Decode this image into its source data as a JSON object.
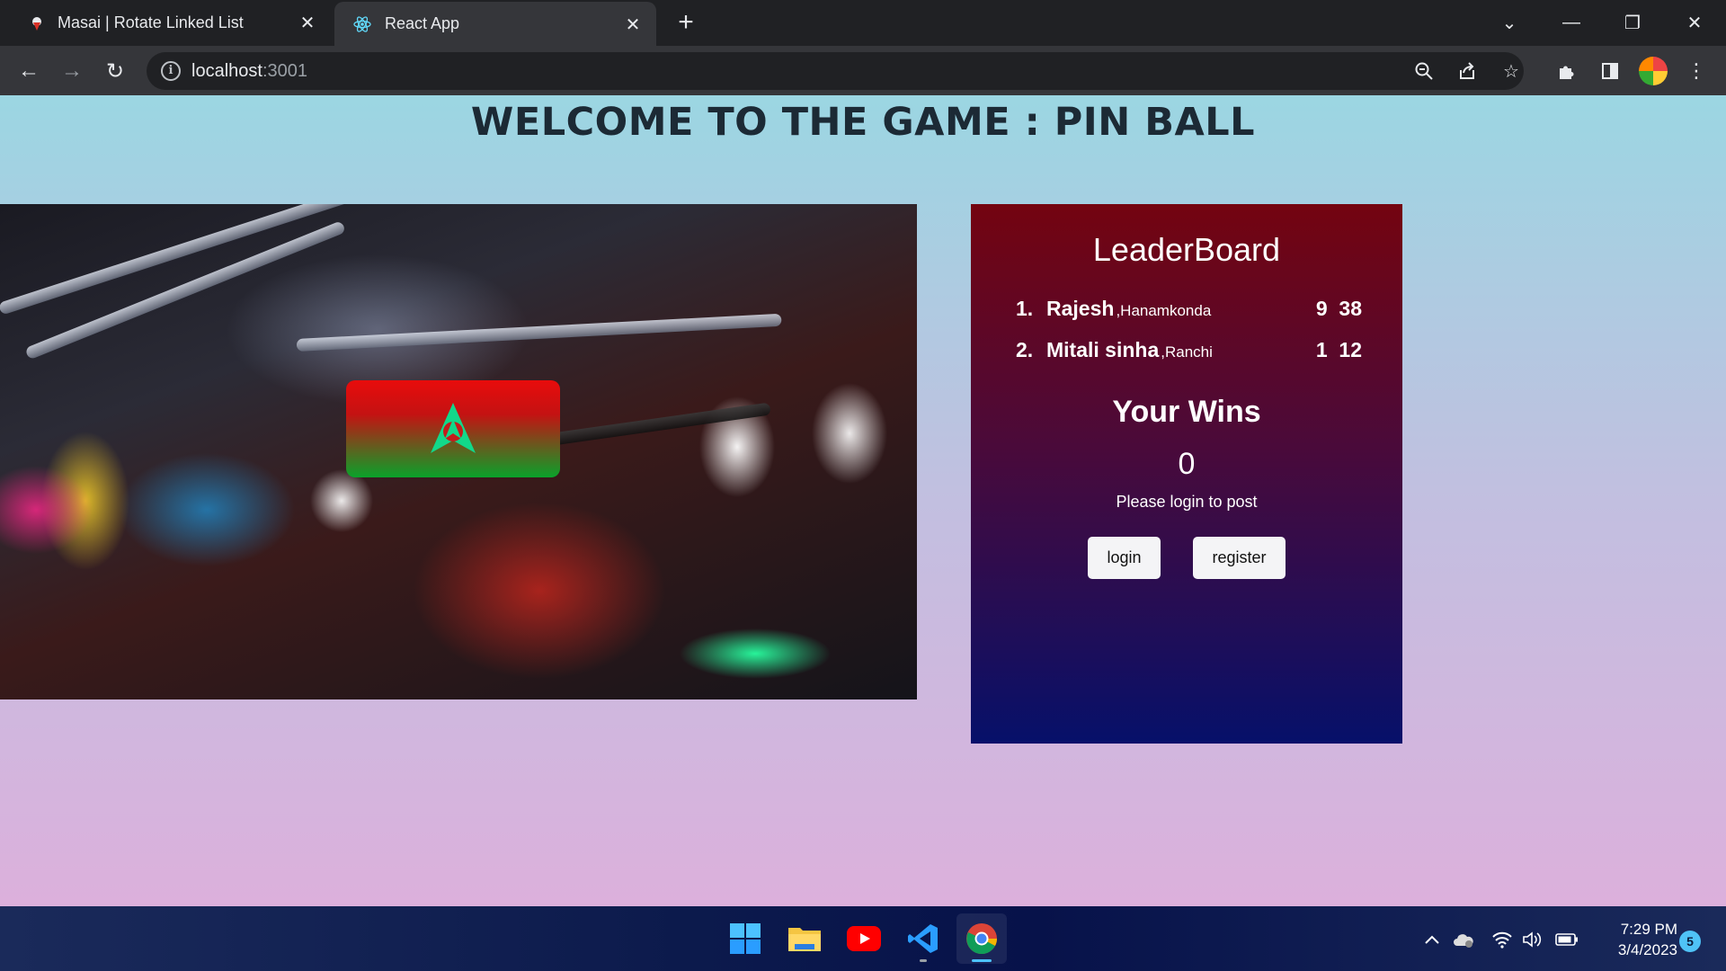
{
  "browser": {
    "tabs": [
      {
        "title": "Masai | Rotate Linked List",
        "favicon": "masai-favicon-icon",
        "active": false
      },
      {
        "title": "React App",
        "favicon": "react-favicon-icon",
        "active": true
      }
    ],
    "address_bar": {
      "host": "localhost",
      "port": ":3001"
    }
  },
  "page": {
    "title": "WELCOME TO THE GAME : PIN BALL",
    "game": {
      "launch_icon": "starfleet-delta-icon"
    },
    "leaderboard": {
      "title": "LeaderBoard",
      "entries": [
        {
          "rank": "1.",
          "name": "Rajesh",
          "city": ",Hanamkonda",
          "score": "9  38"
        },
        {
          "rank": "2.",
          "name": "Mitali sinha",
          "city": ",Ranchi",
          "score": "1  12"
        }
      ],
      "wins_title": "Your Wins",
      "wins_count": "0",
      "login_message": "Please login to post",
      "login_label": "login",
      "register_label": "register"
    }
  },
  "taskbar": {
    "apps": [
      "windows-start-icon",
      "file-explorer-icon",
      "youtube-icon",
      "vscode-icon",
      "chrome-icon"
    ],
    "time": "7:29 PM",
    "date": "3/4/2023",
    "notifications": "5"
  },
  "colors": {
    "leaderboard_top": "#740410",
    "leaderboard_bottom": "#06106a",
    "launch_top": "#e80c0c",
    "launch_bottom": "#0aa22a",
    "page_bg_top": "#9bd6e2",
    "page_bg_bottom": "#dcb0dc"
  }
}
